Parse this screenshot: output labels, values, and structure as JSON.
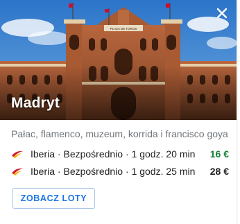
{
  "destination": {
    "city": "Madryt",
    "description": "Pałac, flamenco, muzeum, korrida i francisco goya",
    "sign_text": "PLAZA DE TOROS"
  },
  "flights": [
    {
      "airline": "Iberia",
      "type": "Bezpośrednio",
      "duration": "1 godz. 20 min",
      "price": "16 €",
      "price_color": "#188038"
    },
    {
      "airline": "Iberia",
      "type": "Bezpośrednio",
      "duration": "1 godz. 25 min",
      "price": "28 €",
      "price_color": "#202124"
    }
  ],
  "flight_separator": "·",
  "actions": {
    "see_flights_label": "ZOBACZ LOTY",
    "close_icon": "close-icon"
  },
  "colors": {
    "accent_blue": "#1a73e8",
    "cheap_price": "#188038",
    "iberia_red": "#d7192d",
    "iberia_yellow": "#f6b200"
  }
}
